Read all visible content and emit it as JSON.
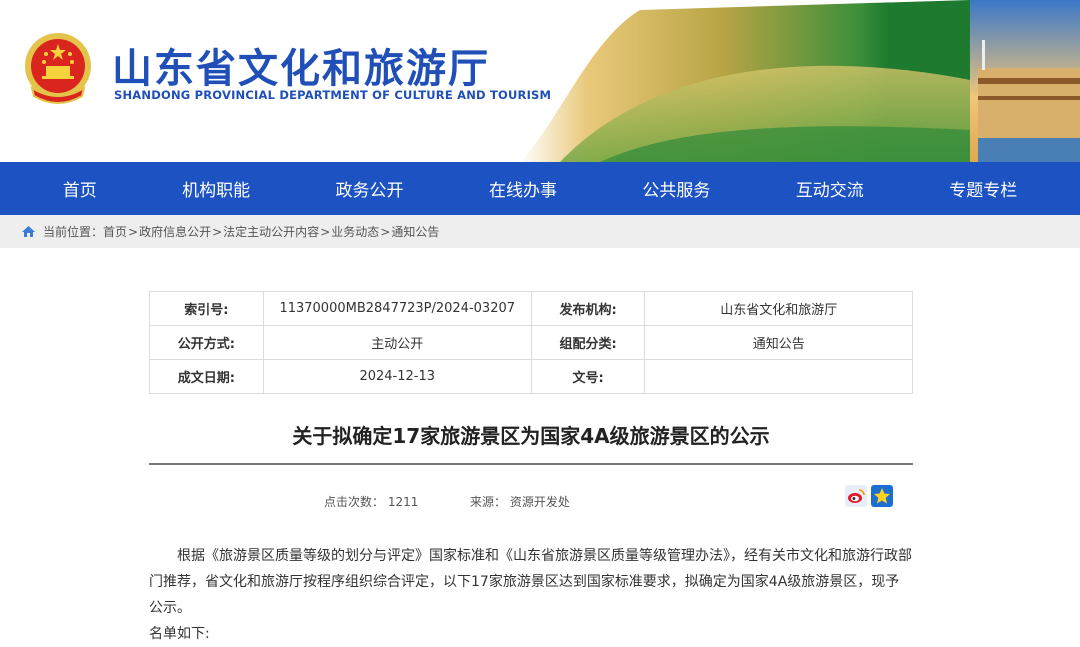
{
  "header": {
    "title": "山东省文化和旅游厅",
    "subtitle": "SHANDONG PROVINCIAL DEPARTMENT OF CULTURE AND  TOURISM"
  },
  "nav": {
    "items": [
      {
        "label": "首页"
      },
      {
        "label": "机构职能"
      },
      {
        "label": "政务公开"
      },
      {
        "label": "在线办事"
      },
      {
        "label": "公共服务"
      },
      {
        "label": "互动交流"
      },
      {
        "label": "专题专栏"
      }
    ]
  },
  "breadcrumb": {
    "prefix": "当前位置：",
    "items": [
      "首页",
      "政府信息公开",
      "法定主动公开内容",
      "业务动态",
      "通知公告"
    ],
    "separator": ">"
  },
  "info": {
    "index_label": "索引号:",
    "index_value": "11370000MB2847723P/2024-03207",
    "publisher_label": "发布机构:",
    "publisher_value": "山东省文化和旅游厅",
    "method_label": "公开方式:",
    "method_value": "主动公开",
    "category_label": "组配分类:",
    "category_value": "通知公告",
    "date_label": "成文日期:",
    "date_value": "2024-12-13",
    "docno_label": "文号:",
    "docno_value": ""
  },
  "article": {
    "title": "关于拟确定17家旅游景区为国家4A级旅游景区的公示",
    "clicks_label": "点击次数：",
    "clicks_value": "1211",
    "source_label": "来源：",
    "source_value": "资源开发处",
    "paragraph": "根据《旅游景区质量等级的划分与评定》国家标准和《山东省旅游景区质量等级管理办法》，经有关市文化和旅游行政部门推荐，省文化和旅游厅按程序组织综合评定，以下17家旅游景区达到国家标准要求，拟确定为国家4A级旅游景区，现予公示。",
    "paragraph2": "名单如下:"
  },
  "colors": {
    "brand": "#1f4fb7",
    "nav_bg": "#1d52c2",
    "crumb_bg": "#eeeeee"
  }
}
